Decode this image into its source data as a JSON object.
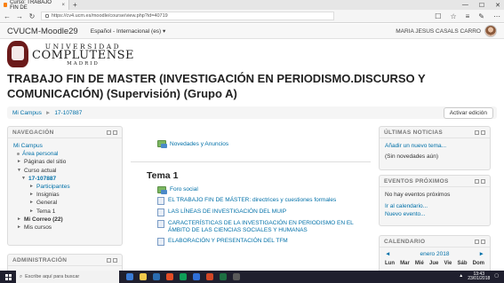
{
  "browser": {
    "tab_title": "Curso: TRABAJO FIN DE",
    "tab_close": "×",
    "new_tab": "+",
    "back": "←",
    "forward": "→",
    "refresh": "↻",
    "url": "https://cv4.ucm.es/moodle/course/view.php?id=40719",
    "tools": [
      "☐",
      "☆",
      "≡",
      "✎",
      "⋯"
    ],
    "window_controls": [
      "—",
      "☐",
      "✕"
    ]
  },
  "moodle_header": {
    "brand": "CVUCM-Moodle29",
    "language": "Español - Internacional (es) ▾",
    "user_name": "MARIA JESUS CASALS CARRO"
  },
  "logo": {
    "line1": "UNIVERSIDAD",
    "line2": "COMPLUTENSE",
    "line3": "MADRID"
  },
  "course_title": "TRABAJO FIN DE MASTER (INVESTIGACIÓN EN PERIODISMO.DISCURSO Y COMUNICACIÓN) (Supervisión) (Grupo A)",
  "breadcrumb": {
    "items": [
      "Mi Campus",
      "17-107887"
    ],
    "separator": "►"
  },
  "edit_button": "Activar edición",
  "navigation": {
    "title": "NAVEGACIÓN",
    "items": [
      {
        "label": "Mi Campus",
        "style": "link"
      },
      {
        "label": "Área personal",
        "style": "bullet-link"
      },
      {
        "label": "Páginas del sitio",
        "style": "arrow"
      },
      {
        "label": "Curso actual",
        "style": "arrow-open"
      },
      {
        "label": "17-107887",
        "style": "sub-open-link-bold"
      },
      {
        "label": "Participantes",
        "style": "sub2-link"
      },
      {
        "label": "Insignias",
        "style": "sub2-arrow"
      },
      {
        "label": "General",
        "style": "sub2-arrow"
      },
      {
        "label": "Tema 1",
        "style": "sub2-arrow"
      },
      {
        "label": "Mi Correo (22)",
        "style": "arrow-bold"
      },
      {
        "label": "Mis cursos",
        "style": "arrow"
      }
    ]
  },
  "admin_block": {
    "title": "ADMINISTRACIÓN"
  },
  "main": {
    "section0_link": "Novedades y Anuncios",
    "topic_title": "Tema 1",
    "activities": [
      {
        "label": "Foro social",
        "icon": "forum-icon"
      },
      {
        "label": "EL TRABAJO FIN DE MÁSTER: directrices y cuestiones formales",
        "icon": "file-icon"
      },
      {
        "label": "LAS LÍNEAS DE INVESTIGACIÓN DEL MUIP",
        "icon": "file-icon"
      },
      {
        "label": "CARACTERÍSTICAS DE LA INVESTIGACIÓN EN PERIODISMO EN EL ÁMBITO DE LAS CIENCIAS SOCIALES Y HUMANAS",
        "icon": "file-icon"
      },
      {
        "label": "ELABORACIÓN Y PRESENTACIÓN DEL TFM",
        "icon": "file-icon"
      }
    ]
  },
  "news_block": {
    "title": "ÚLTIMAS NOTICIAS",
    "add_link": "Añadir un nuevo tema...",
    "empty": "(Sin novedades aún)"
  },
  "events_block": {
    "title": "EVENTOS PRÓXIMOS",
    "empty": "No hay eventos próximos",
    "calendar_link": "Ir al calendario...",
    "new_event_link": "Nuevo evento..."
  },
  "calendar_block": {
    "title": "CALENDARIO",
    "prev": "◄",
    "month": "enero 2018",
    "next": "►",
    "weekdays": [
      "Lun",
      "Mar",
      "Mié",
      "Jue",
      "Vie",
      "Sáb",
      "Dom"
    ]
  },
  "taskbar": {
    "search_placeholder": "Escribe aquí para buscar",
    "time": "13:43",
    "date": "23/01/2018"
  },
  "colors": {
    "link": "#0070a8",
    "taskbar": "#1f1f2e"
  }
}
